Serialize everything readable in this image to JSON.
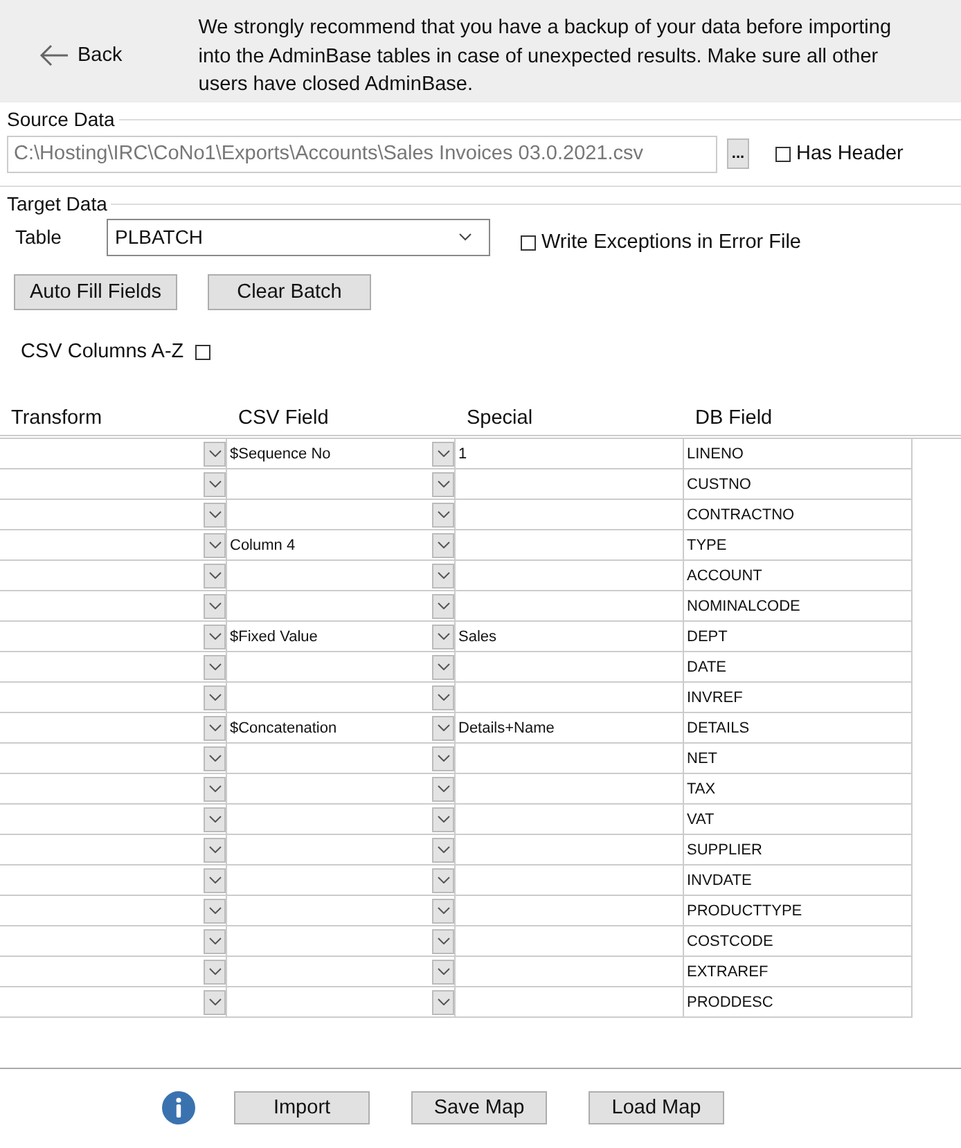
{
  "header": {
    "back": "Back",
    "message": "We strongly recommend that you have a backup of your data before importing into the AdminBase tables in case of unexpected results. Make sure all other users have closed AdminBase."
  },
  "source": {
    "title": "Source Data",
    "path": "C:\\Hosting\\IRC\\CoNo1\\Exports\\Accounts\\Sales Invoices 03.0.2021.csv",
    "browse": "...",
    "has_header": {
      "label": "Has Header",
      "checked": false
    }
  },
  "target": {
    "title": "Target Data",
    "table_label": "Table",
    "table": "PLBATCH",
    "write_exceptions": {
      "label": "Write Exceptions in Error File",
      "checked": false
    },
    "buttons": [
      "Auto Fill Fields",
      "Clear Batch"
    ],
    "csv_az": {
      "label": "CSV Columns A-Z",
      "checked": false
    }
  },
  "grid": {
    "columns": [
      "Transform",
      "CSV Field",
      "Special",
      "DB Field"
    ],
    "rows": [
      {
        "csv": "$Sequence No",
        "special": "1",
        "db": "LINENO"
      },
      {
        "db": "CUSTNO"
      },
      {
        "db": "CONTRACTNO"
      },
      {
        "csv": "Column 4",
        "db": "TYPE"
      },
      {
        "db": "ACCOUNT"
      },
      {
        "db": "NOMINALCODE"
      },
      {
        "csv": "$Fixed Value",
        "special": "Sales",
        "db": "DEPT"
      },
      {
        "db": "DATE"
      },
      {
        "db": "INVREF"
      },
      {
        "csv": "$Concatenation",
        "special": "Details+Name",
        "db": "DETAILS"
      },
      {
        "db": "NET"
      },
      {
        "db": "TAX"
      },
      {
        "db": "VAT"
      },
      {
        "db": "SUPPLIER"
      },
      {
        "db": "INVDATE"
      },
      {
        "db": "PRODUCTTYPE"
      },
      {
        "db": "COSTCODE"
      },
      {
        "db": "EXTRAREF"
      },
      {
        "db": "PRODDESC"
      }
    ]
  },
  "footer": {
    "buttons": [
      "Import",
      "Save Map",
      "Load Map"
    ]
  }
}
